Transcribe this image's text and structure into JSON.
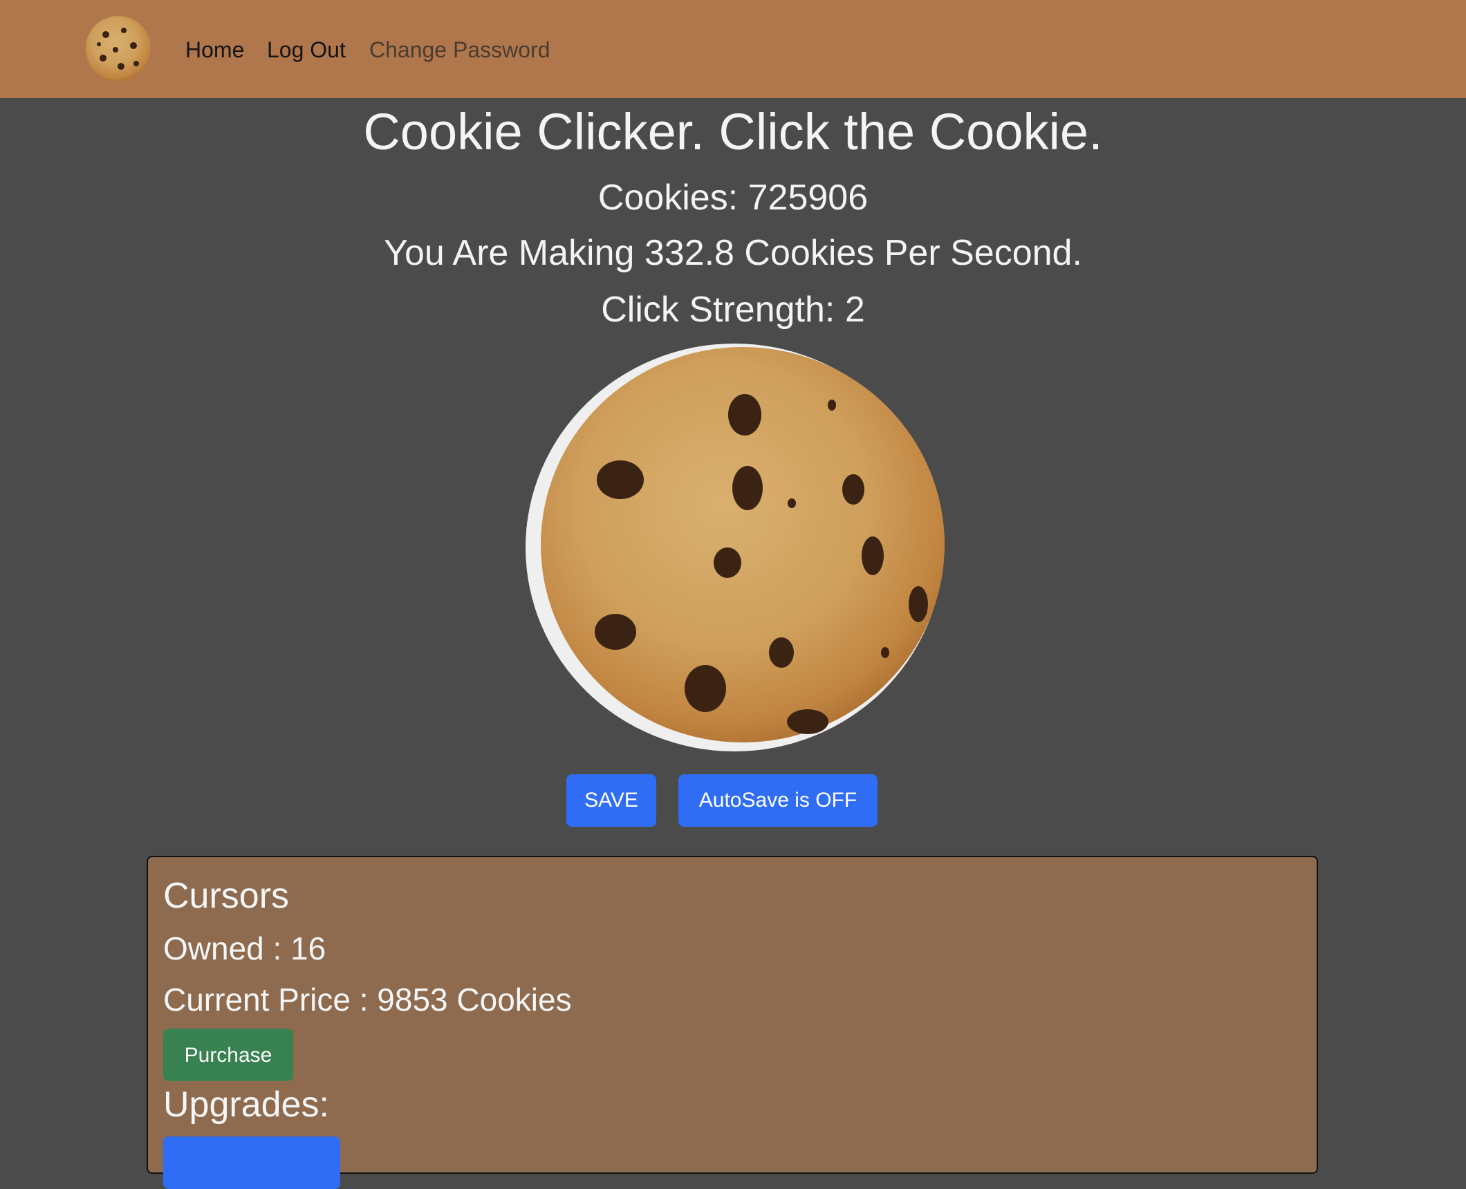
{
  "nav": {
    "logo_icon": "cookie-icon",
    "links": [
      "Home",
      "Log Out",
      "Change Password"
    ]
  },
  "main": {
    "title": "Cookie Clicker. Click the Cookie.",
    "cookies": "Cookies: 725906",
    "rate": "You Are Making 332.8 Cookies Per Second.",
    "click_strength": "Click Strength: 2",
    "cookie_image": "chocolate-chip-cookie-image"
  },
  "controls": {
    "save_label": "SAVE",
    "autosave_label": "AutoSave is OFF"
  },
  "building": {
    "name": "Cursors",
    "owned": "Owned : 16",
    "price": "Current Price : 9853 Cookies",
    "purchase_label": "Purchase",
    "upgrades_heading": "Upgrades:"
  },
  "colors": {
    "navbar": "#b1774c",
    "background": "#4b4b4b",
    "panel": "#8e6a4e",
    "primary_button": "#2f6df5",
    "purchase_button": "#388150"
  }
}
